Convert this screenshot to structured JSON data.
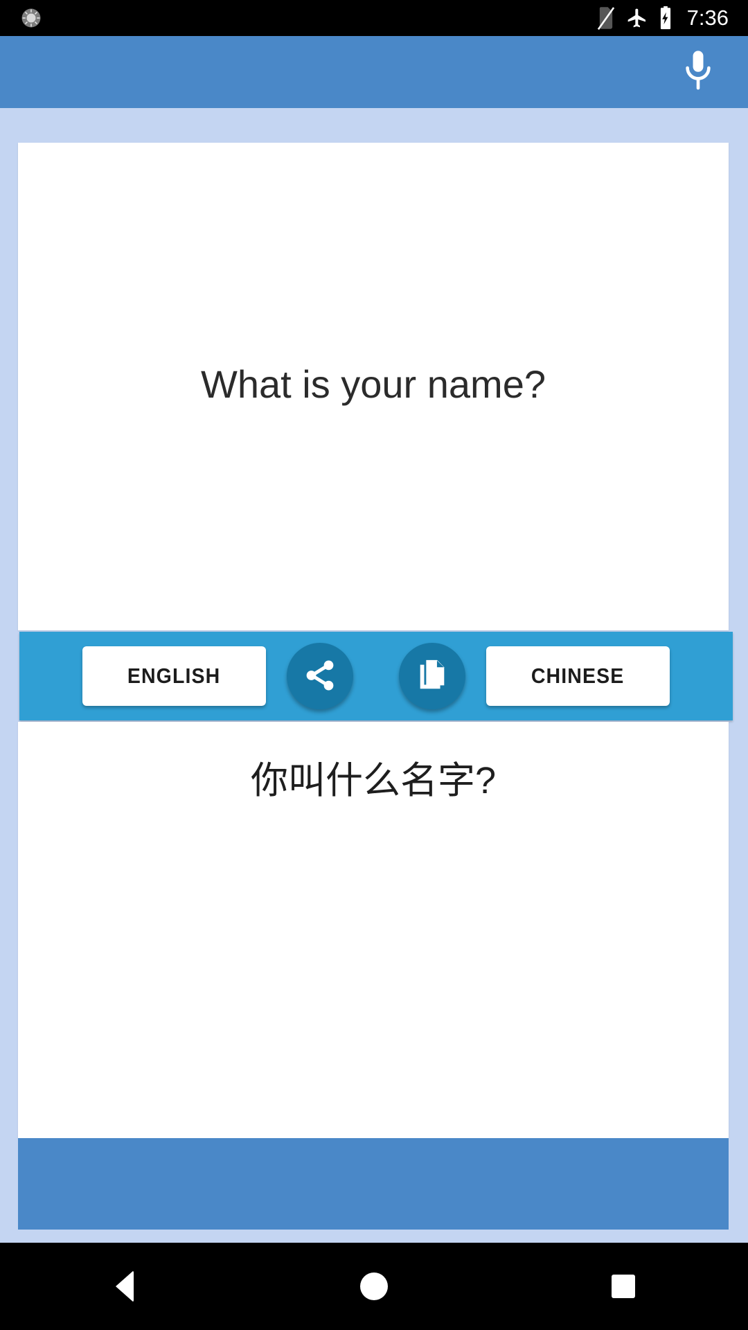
{
  "status_bar": {
    "notification_icon": "brightness-gauge-icon",
    "icons": [
      "no-sim-icon",
      "airplane-mode-icon",
      "battery-charging-icon"
    ],
    "time": "7:36"
  },
  "app_bar": {
    "mic_icon": "microphone-icon",
    "background_color": "#4a88c8"
  },
  "translation": {
    "source_text": "What is your name?",
    "target_text": "你叫什么名字?"
  },
  "action_bar": {
    "background_color": "#309fd4",
    "fab_color": "#1778a6",
    "source_language": "ENGLISH",
    "target_language": "CHINESE",
    "share_icon": "share-icon",
    "copy_icon": "copy-icon"
  },
  "nav_bar": {
    "back": "back-triangle-icon",
    "home": "home-circle-icon",
    "recents": "recents-square-icon"
  }
}
